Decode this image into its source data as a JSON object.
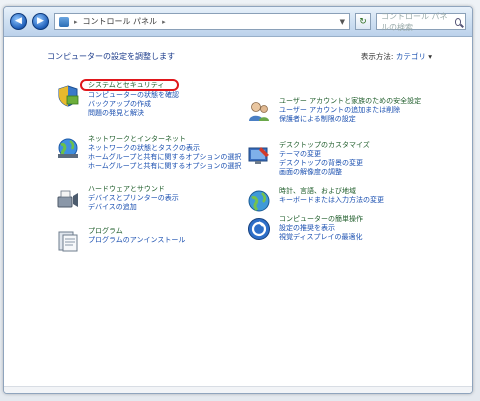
{
  "window": {
    "breadcrumb": [
      "コントロール パネル"
    ],
    "search_placeholder": "コントロール パネルの検索"
  },
  "header": {
    "title": "コンピューターの設定を調整します",
    "view_by_label": "表示方法:",
    "view_by_value": "カテゴリ"
  },
  "categories_left": [
    {
      "icon": "system-security-icon",
      "head": "システムとセキュリティ",
      "subs": [
        "コンピューターの状態を確認",
        "バックアップの作成",
        "問題の発見と解決"
      ]
    },
    {
      "icon": "network-internet-icon",
      "head": "ネットワークとインターネット",
      "subs": [
        "ネットワークの状態とタスクの表示",
        "ホームグループと共有に関するオプションの選択",
        "ホームグループと共有に関するオプションの選択"
      ]
    },
    {
      "icon": "hardware-sound-icon",
      "head": "ハードウェアとサウンド",
      "subs": [
        "デバイスとプリンターの表示",
        "デバイスの追加"
      ]
    },
    {
      "icon": "programs-icon",
      "head": "プログラム",
      "subs": [
        "プログラムのアンインストール"
      ]
    }
  ],
  "categories_right": [
    {
      "icon": "user-accounts-icon",
      "head": "ユーザー アカウントと家族のための安全設定",
      "subs": [
        "ユーザー アカウントの追加または削除",
        "保護者による制限の設定"
      ]
    },
    {
      "icon": "appearance-icon",
      "head": "デスクトップのカスタマイズ",
      "subs": [
        "テーマの変更",
        "デスクトップの背景の変更",
        "画面の解像度の調整"
      ]
    },
    {
      "icon": "clock-region-icon",
      "head": "時計、言語、および地域",
      "subs": [
        "キーボードまたは入力方法の変更"
      ]
    },
    {
      "icon": "ease-of-access-icon",
      "head": "コンピューターの簡単操作",
      "subs": [
        "設定の推奨を表示",
        "視覚ディスプレイの最適化"
      ]
    }
  ]
}
